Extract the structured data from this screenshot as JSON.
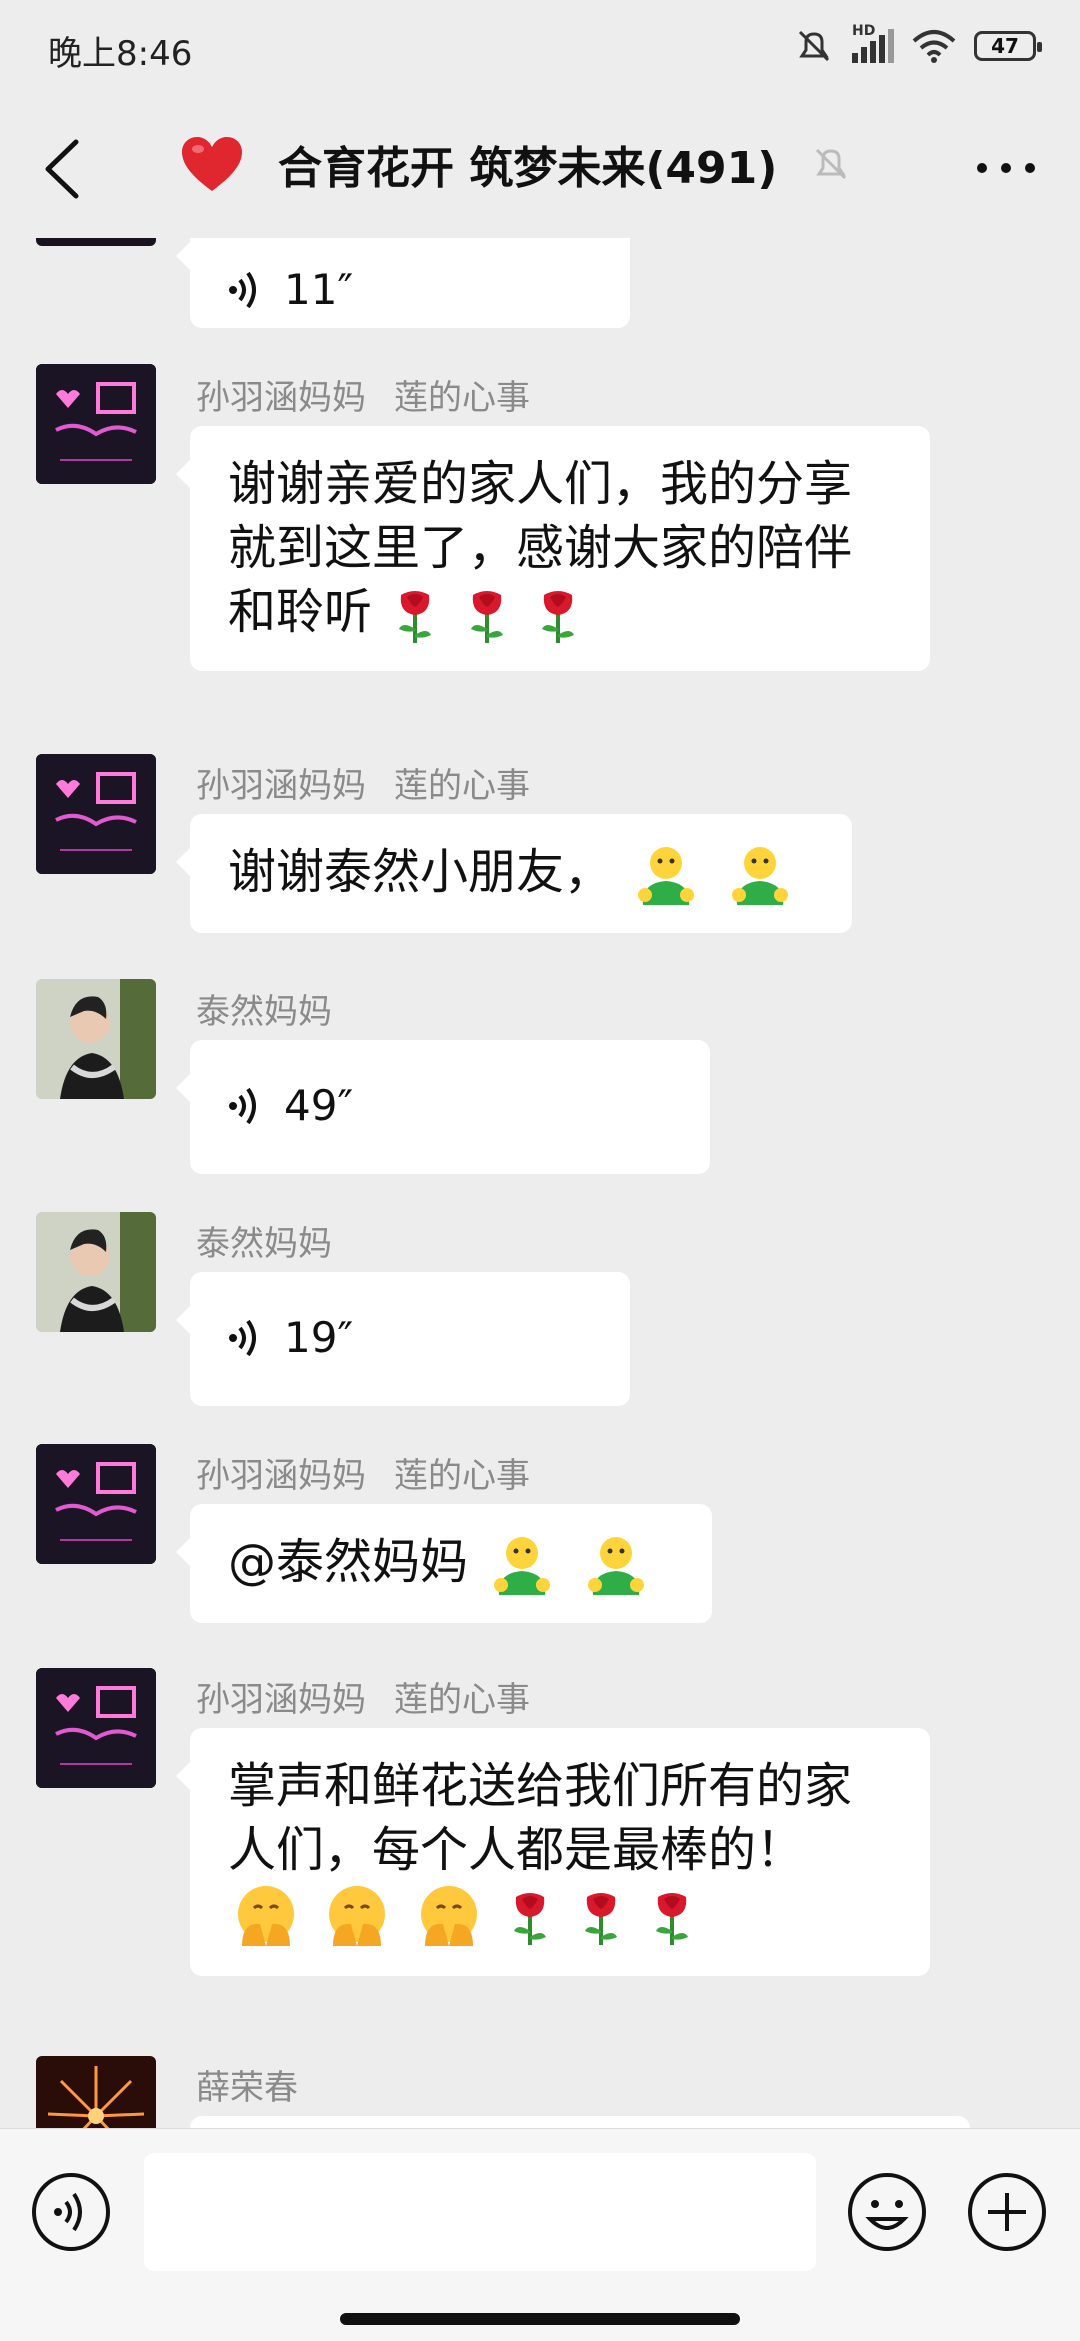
{
  "status": {
    "time": "晚上8:46",
    "battery": "47",
    "network": "HD"
  },
  "header": {
    "title": "合育花开 筑梦未来(491)"
  },
  "messages": [
    {
      "voice": "11″"
    },
    {
      "sender": "孙羽涵妈妈",
      "group_nick": "莲的心事",
      "text": "谢谢亲爱的家人们，我的分享就到这里了，感谢大家的陪伴和聆听"
    },
    {
      "sender": "孙羽涵妈妈",
      "group_nick": "莲的心事",
      "text": "谢谢泰然小朋友，"
    },
    {
      "sender": "泰然妈妈",
      "voice": "49″"
    },
    {
      "sender": "泰然妈妈",
      "voice": "19″"
    },
    {
      "sender": "孙羽涵妈妈",
      "group_nick": "莲的心事",
      "text": "@泰然妈妈 "
    },
    {
      "sender": "孙羽涵妈妈",
      "group_nick": "莲的心事",
      "text": "掌声和鲜花送给我们所有的家人们，每个人都是最棒的！"
    },
    {
      "sender": "薛荣春"
    }
  ],
  "colors": {
    "background": "#EDEDED",
    "bubble": "#FFFFFF",
    "sender": "#8A8A8A"
  },
  "icons": [
    "back-icon",
    "heart-icon",
    "mute-bell-icon",
    "more-icon",
    "voice-wave-icon",
    "rose-emoji",
    "hug-emoji",
    "facepalm-emoji",
    "emoji-icon",
    "plus-icon"
  ]
}
